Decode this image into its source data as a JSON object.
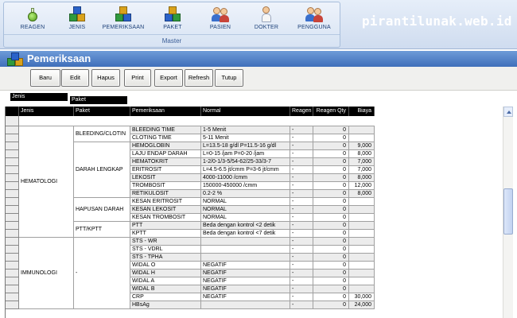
{
  "ribbon": {
    "group_label": "Master",
    "buttons": [
      {
        "label": "REAGEN",
        "icon": "flask-icon"
      },
      {
        "label": "JENIS",
        "icon": "cubes-icon"
      },
      {
        "label": "PEMERIKSAAN",
        "icon": "cubes-icon"
      },
      {
        "label": "PAKET",
        "icon": "cubes-icon"
      },
      {
        "label": "PASIEN",
        "icon": "users-icon"
      },
      {
        "label": "DOKTER",
        "icon": "doctor-icon"
      },
      {
        "label": "PENGGUNA",
        "icon": "users-icon"
      }
    ]
  },
  "watermark": "pirantilunak.web.id",
  "window": {
    "title": "Pemeriksaan",
    "icon": "cubes-icon",
    "title_color": "#4a78c2"
  },
  "toolbar": {
    "buttons": [
      "Baru",
      "Edit",
      "Hapus",
      "Print",
      "Export",
      "Refresh",
      "Tutup"
    ]
  },
  "grouping": {
    "level1": "Jenis",
    "level2": "Paket"
  },
  "grid": {
    "columns": [
      "Jenis",
      "Paket",
      "Pemeriksaan",
      "Normal",
      "Reagen",
      "Reagen Qty",
      "Biaya"
    ],
    "groups": [
      {
        "jenis": "HEMATOLOGI",
        "pakets": [
          {
            "paket": "BLEEDING/CLOTIN",
            "rows": [
              [
                "BLEEDING TIME",
                "1-5 Menit",
                "-",
                "0",
                ""
              ],
              [
                "CLOTING TIME",
                "5-11 Menit",
                "-",
                "0",
                ""
              ]
            ]
          },
          {
            "paket": "DARAH LENGKAP",
            "rows": [
              [
                "HEMOGLOBIN",
                "L=13.5-18 g/dl  P=11.5-16 g/dl",
                "-",
                "0",
                "9,000"
              ],
              [
                "LAJU ENDAP DARAH",
                "L=0-15 /jam P=0-20 /jam",
                "-",
                "0",
                "8,000"
              ],
              [
                "HEMATOKRIT",
                "1-2/0-1/3-5/54-62/25-33/3-7",
                "-",
                "0",
                "7,000"
              ],
              [
                "ERITROSIT",
                "L=4.5-6.5 jt/cmm P=3-6 jt/cmm",
                "-",
                "0",
                "7,000"
              ],
              [
                "LEKOSIT",
                "4000-11000 /cmm",
                "-",
                "0",
                "8,000"
              ],
              [
                "TROMBOSIT",
                "150000-450000 /cmm",
                "-",
                "0",
                "12,000"
              ],
              [
                "RETIKULOSIT",
                "0.2-2 %",
                "-",
                "0",
                "8,000"
              ]
            ]
          },
          {
            "paket": "HAPUSAN DARAH",
            "rows": [
              [
                "KESAN ERITROSIT",
                "NORMAL",
                "-",
                "0",
                ""
              ],
              [
                "KESAN LEKOSIT",
                "NORMAL",
                "-",
                "0",
                ""
              ],
              [
                "KESAN TROMBOSIT",
                "NORMAL",
                "-",
                "0",
                ""
              ]
            ]
          },
          {
            "paket": "PTT/KPTT",
            "rows": [
              [
                "PTT",
                "Beda dengan kontrol <2 detik",
                "-",
                "0",
                ""
              ],
              [
                "KPTT",
                "Beda dengan kontrol <7 detik",
                "-",
                "0",
                ""
              ]
            ]
          }
        ]
      },
      {
        "jenis": "IMMUNOLOGI",
        "pakets": [
          {
            "paket": "-",
            "rows": [
              [
                "STS - WR",
                "",
                "-",
                "0",
                ""
              ],
              [
                "STS - VDRL",
                "",
                "-",
                "0",
                ""
              ],
              [
                "STS - TPHA",
                "",
                "-",
                "0",
                ""
              ],
              [
                "WIDAL O",
                "NEGATIF",
                "-",
                "0",
                ""
              ],
              [
                "WIDAL H",
                "NEGATIF",
                "-",
                "0",
                ""
              ],
              [
                "WIDAL A",
                "NEGATIF",
                "-",
                "0",
                ""
              ],
              [
                "WIDAL B",
                "NEGATIF",
                "-",
                "0",
                ""
              ],
              [
                "CRP",
                "NEGATIF",
                "-",
                "0",
                "30,000"
              ],
              [
                "HBsAg",
                "",
                "-",
                "0",
                "24,000"
              ]
            ]
          }
        ]
      }
    ]
  }
}
